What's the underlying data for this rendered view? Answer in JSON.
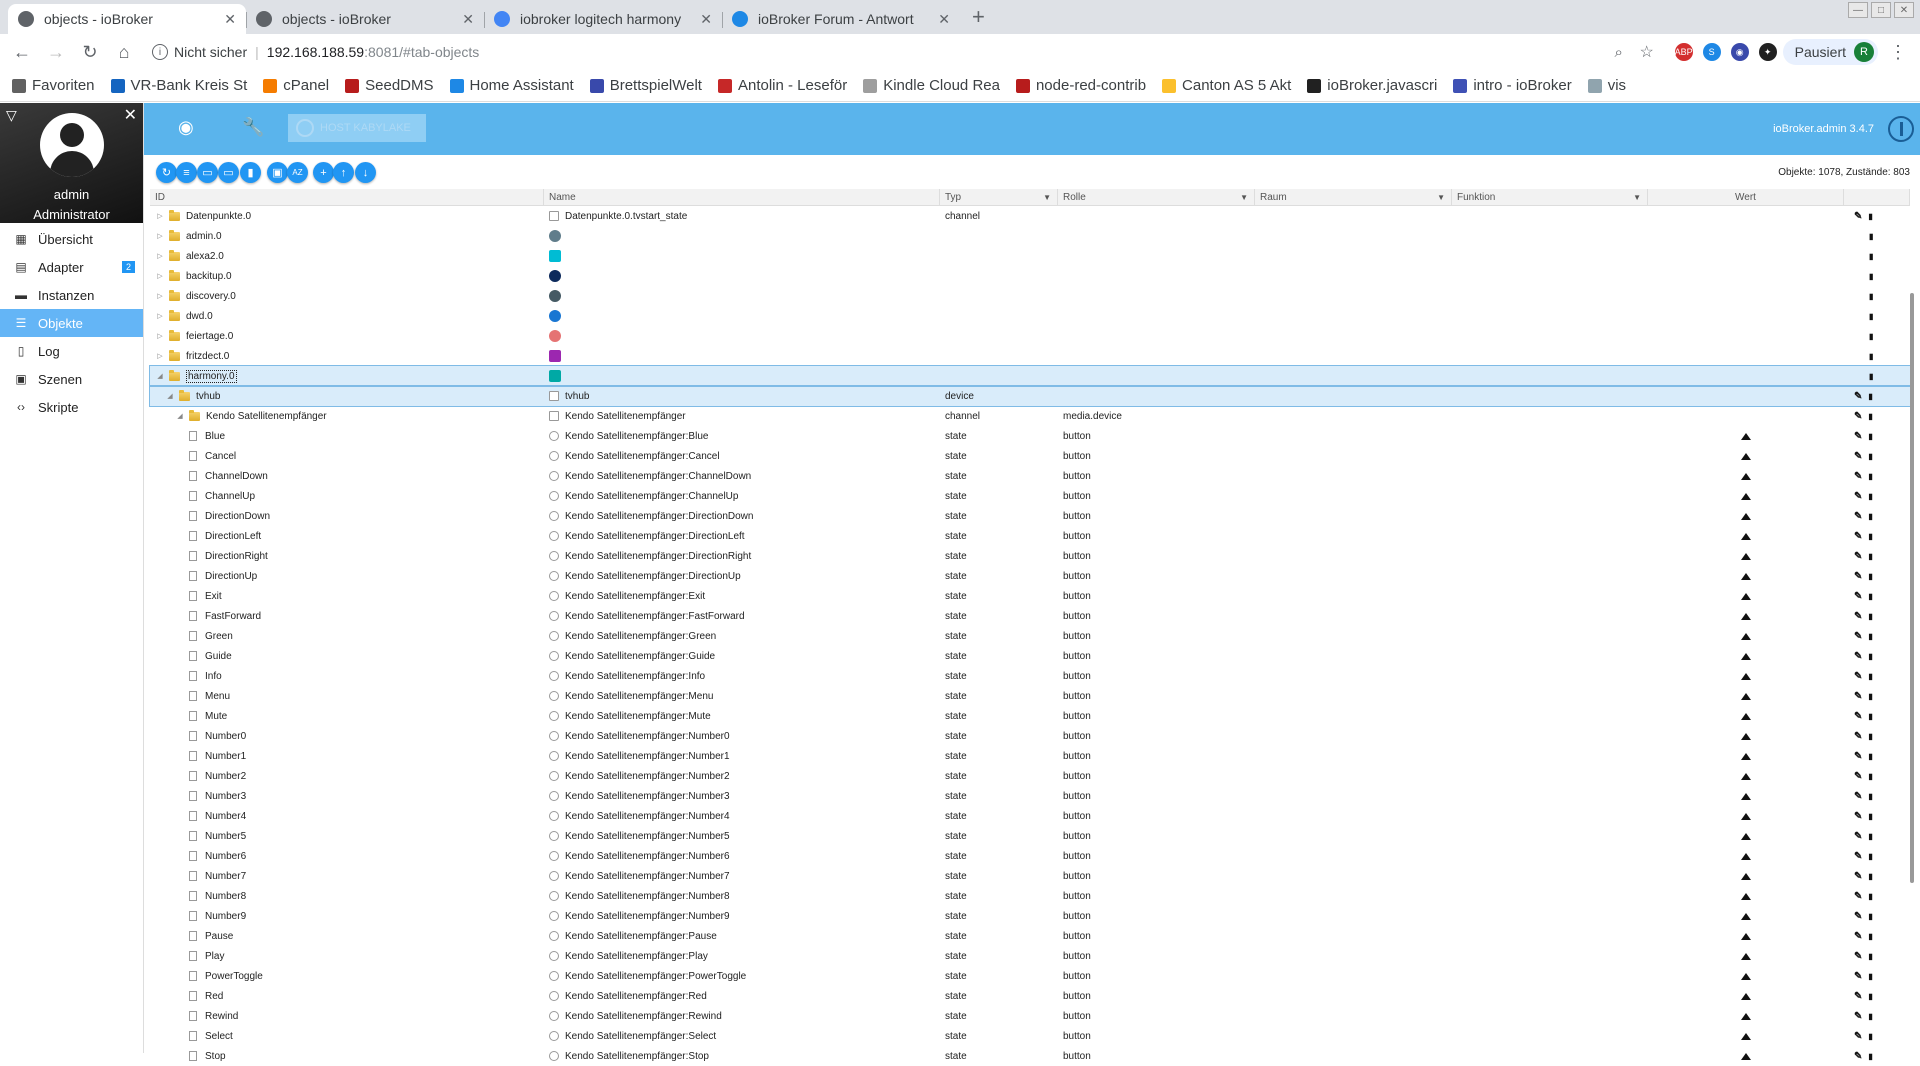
{
  "browser": {
    "tabs": [
      {
        "title": "objects - ioBroker",
        "active": true
      },
      {
        "title": "objects - ioBroker",
        "active": false
      },
      {
        "title": "iobroker logitech harmony",
        "active": false
      },
      {
        "title": "ioBroker Forum - Antwort",
        "active": false
      }
    ],
    "new_tab": "+",
    "url": {
      "security": "Nicht sicher",
      "host": "192.168.188.59",
      "path": ":8081/#tab-objects"
    },
    "profile": {
      "label": "Pausiert",
      "initial": "R"
    },
    "bookmarks": [
      "Favoriten",
      "VR-Bank Kreis St",
      "cPanel",
      "SeedDMS",
      "Home Assistant",
      "BrettspielWelt",
      "Antolin - Leseför",
      "Kindle Cloud Rea",
      "node-red-contrib",
      "Canton AS 5 Akt",
      "ioBroker.javascri",
      "intro - ioBroker",
      "vis"
    ],
    "extensions": [
      {
        "label": "ABP",
        "color": "#d32f2f"
      },
      {
        "label": "S",
        "color": "#1e88e5"
      },
      {
        "label": "◉",
        "color": "#3949ab"
      },
      {
        "label": "✦",
        "color": "#212121"
      }
    ]
  },
  "sidebar": {
    "user_name": "admin",
    "user_role": "Administrator",
    "items": [
      {
        "label": "Übersicht",
        "icon": "grid-icon",
        "glyph": "▦"
      },
      {
        "label": "Adapter",
        "icon": "store-icon",
        "glyph": "▤",
        "badge": "2"
      },
      {
        "label": "Instanzen",
        "icon": "instances-icon",
        "glyph": "▬"
      },
      {
        "label": "Objekte",
        "icon": "list-icon",
        "glyph": "☰",
        "active": true
      },
      {
        "label": "Log",
        "icon": "document-icon",
        "glyph": "▯"
      },
      {
        "label": "Szenen",
        "icon": "scenes-icon",
        "glyph": "▣"
      },
      {
        "label": "Skripte",
        "icon": "code-icon",
        "glyph": "‹›"
      }
    ]
  },
  "topbar": {
    "host_button": "HOST KABYLAKE",
    "version": "ioBroker.admin 3.4.7"
  },
  "toolbar_buttons": [
    {
      "name": "refresh",
      "glyph": "↻"
    },
    {
      "name": "list-view",
      "glyph": "≡"
    },
    {
      "name": "folder",
      "glyph": "▭"
    },
    {
      "name": "folder-open",
      "glyph": "▭"
    },
    {
      "name": "delete",
      "glyph": "▮"
    },
    {
      "name": "user",
      "glyph": "▣"
    },
    {
      "name": "sort-az",
      "glyph": "AZ"
    },
    {
      "name": "add",
      "glyph": "+"
    },
    {
      "name": "upload",
      "glyph": "↑"
    },
    {
      "name": "download",
      "glyph": "↓"
    }
  ],
  "counts": "Objekte: 1078, Zustände: 803",
  "columns": {
    "id": "ID",
    "name": "Name",
    "typ": "Typ",
    "rolle": "Rolle",
    "raum": "Raum",
    "funktion": "Funktion",
    "wert": "Wert"
  },
  "top_rows": [
    {
      "id": "Datenpunkte.0",
      "name": "Datenpunkte.0.tvstart_state",
      "typ": "channel",
      "icon": "channel",
      "edit": true
    },
    {
      "id": "admin.0",
      "name": "",
      "typ": "",
      "icon": "admin",
      "edit": false
    },
    {
      "id": "alexa2.0",
      "name": "",
      "typ": "",
      "icon": "alexa",
      "edit": false
    },
    {
      "id": "backitup.0",
      "name": "",
      "typ": "",
      "icon": "backitup",
      "edit": false
    },
    {
      "id": "discovery.0",
      "name": "",
      "typ": "",
      "icon": "discovery",
      "edit": false
    },
    {
      "id": "dwd.0",
      "name": "",
      "typ": "",
      "icon": "dwd",
      "edit": false
    },
    {
      "id": "feiertage.0",
      "name": "",
      "typ": "",
      "icon": "feiertage",
      "edit": false
    },
    {
      "id": "fritzdect.0",
      "name": "",
      "typ": "",
      "icon": "fritzdect",
      "edit": false
    },
    {
      "id": "harmony.0",
      "name": "",
      "typ": "",
      "icon": "harmony",
      "edit": false,
      "selected": true
    },
    {
      "id": "tvhub",
      "name": "tvhub",
      "typ": "device",
      "icon": "device",
      "edit": true,
      "selected": true,
      "level": 1
    },
    {
      "id": "Kendo Satellitenempfänger",
      "name": "Kendo Satellitenempfänger",
      "typ": "channel",
      "rolle": "media.device",
      "icon": "channel",
      "edit": true,
      "level": 2
    }
  ],
  "state_prefix": "Kendo Satellitenempfänger:",
  "state_typ": "state",
  "state_rolle": "button",
  "states": [
    "Blue",
    "Cancel",
    "ChannelDown",
    "ChannelUp",
    "DirectionDown",
    "DirectionLeft",
    "DirectionRight",
    "DirectionUp",
    "Exit",
    "FastForward",
    "Green",
    "Guide",
    "Info",
    "Menu",
    "Mute",
    "Number0",
    "Number1",
    "Number2",
    "Number3",
    "Number4",
    "Number5",
    "Number6",
    "Number7",
    "Number8",
    "Number9",
    "Pause",
    "Play",
    "PowerToggle",
    "Red",
    "Rewind",
    "Select",
    "Stop"
  ]
}
